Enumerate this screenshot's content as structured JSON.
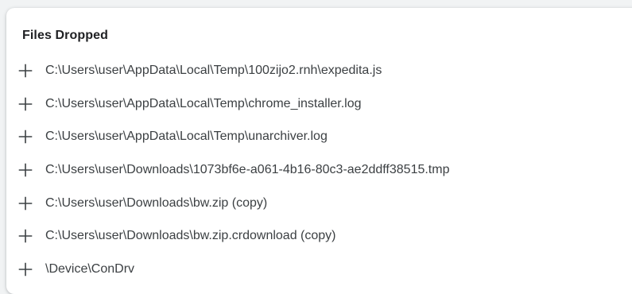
{
  "section": {
    "title": "Files Dropped",
    "expand_icon": "plus-icon",
    "files": [
      "C:\\Users\\user\\AppData\\Local\\Temp\\100zijo2.rnh\\expedita.js",
      "C:\\Users\\user\\AppData\\Local\\Temp\\chrome_installer.log",
      "C:\\Users\\user\\AppData\\Local\\Temp\\unarchiver.log",
      "C:\\Users\\user\\Downloads\\1073bf6e-a061-4b16-80c3-ae2ddff38515.tmp",
      "C:\\Users\\user\\Downloads\\bw.zip (copy)",
      "C:\\Users\\user\\Downloads\\bw.zip.crdownload (copy)",
      "\\Device\\ConDrv"
    ]
  }
}
